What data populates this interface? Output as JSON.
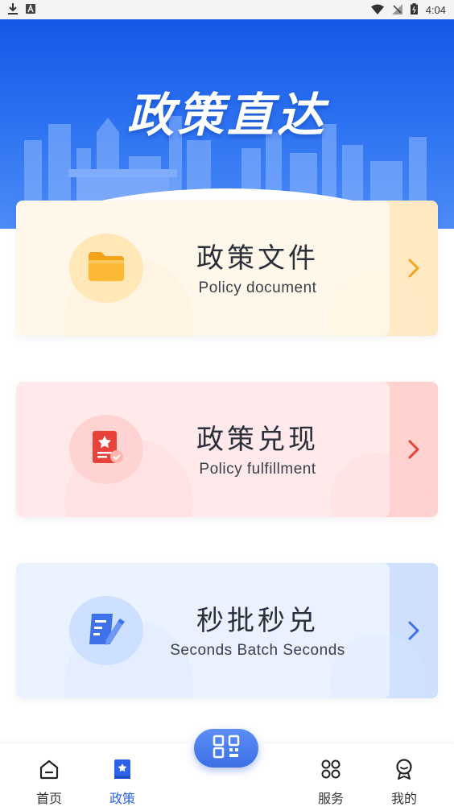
{
  "status_bar": {
    "time": "4:04",
    "left_icons": [
      "download-icon",
      "a-badge-icon"
    ],
    "right_icons": [
      "wifi-icon",
      "no-signal-icon",
      "battery-icon"
    ]
  },
  "hero": {
    "title": "政策直达",
    "colors": {
      "top": "#1558e6",
      "bottom": "#4d8cf6"
    }
  },
  "cards": [
    {
      "title": "政策文件",
      "subtitle": "Policy document",
      "icon": "folder-icon",
      "colors": {
        "main": "#fff8ea",
        "side": "#ffe9c2",
        "accent": "#f6a516",
        "circle": "#ffe7b8"
      }
    },
    {
      "title": "政策兑现",
      "subtitle": "Policy fulfillment",
      "icon": "certificate-icon",
      "colors": {
        "main": "#ffe9ea",
        "side": "#ffd1cf",
        "accent": "#e8433a",
        "circle": "#ffd3d1"
      }
    },
    {
      "title": "秒批秒兑",
      "subtitle": "Seconds Batch Seconds",
      "icon": "edit-document-icon",
      "colors": {
        "main": "#eaf2ff",
        "side": "#cfe0ff",
        "accent": "#3f72ea",
        "circle": "#cde0ff"
      }
    }
  ],
  "bottom_nav": {
    "items": [
      {
        "label": "首页",
        "icon": "home-icon",
        "active": false
      },
      {
        "label": "政策",
        "icon": "policy-book-icon",
        "active": true
      },
      {
        "label": "服务",
        "icon": "grid-apps-icon",
        "active": false
      },
      {
        "label": "我的",
        "icon": "profile-badge-icon",
        "active": false
      }
    ],
    "center_button_icon": "qr-code-icon",
    "active_color": "#2b62e8"
  }
}
